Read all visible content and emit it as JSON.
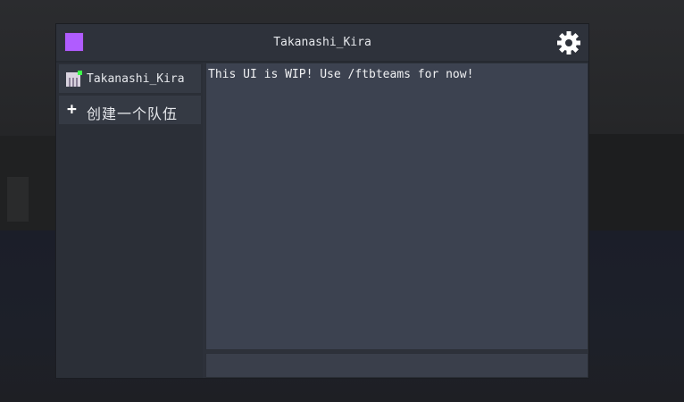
{
  "window": {
    "title": "Takanashi_Kira",
    "team_color": "#b05cff"
  },
  "sidebar": {
    "items": [
      {
        "label": "Takanashi_Kira",
        "status_color": "#3cff4a"
      },
      {
        "label": "创建一个队伍",
        "icon": "plus-icon"
      }
    ]
  },
  "main": {
    "message": "This UI is WIP! Use /ftbteams for now!"
  },
  "icons": {
    "settings": "gear-icon"
  }
}
